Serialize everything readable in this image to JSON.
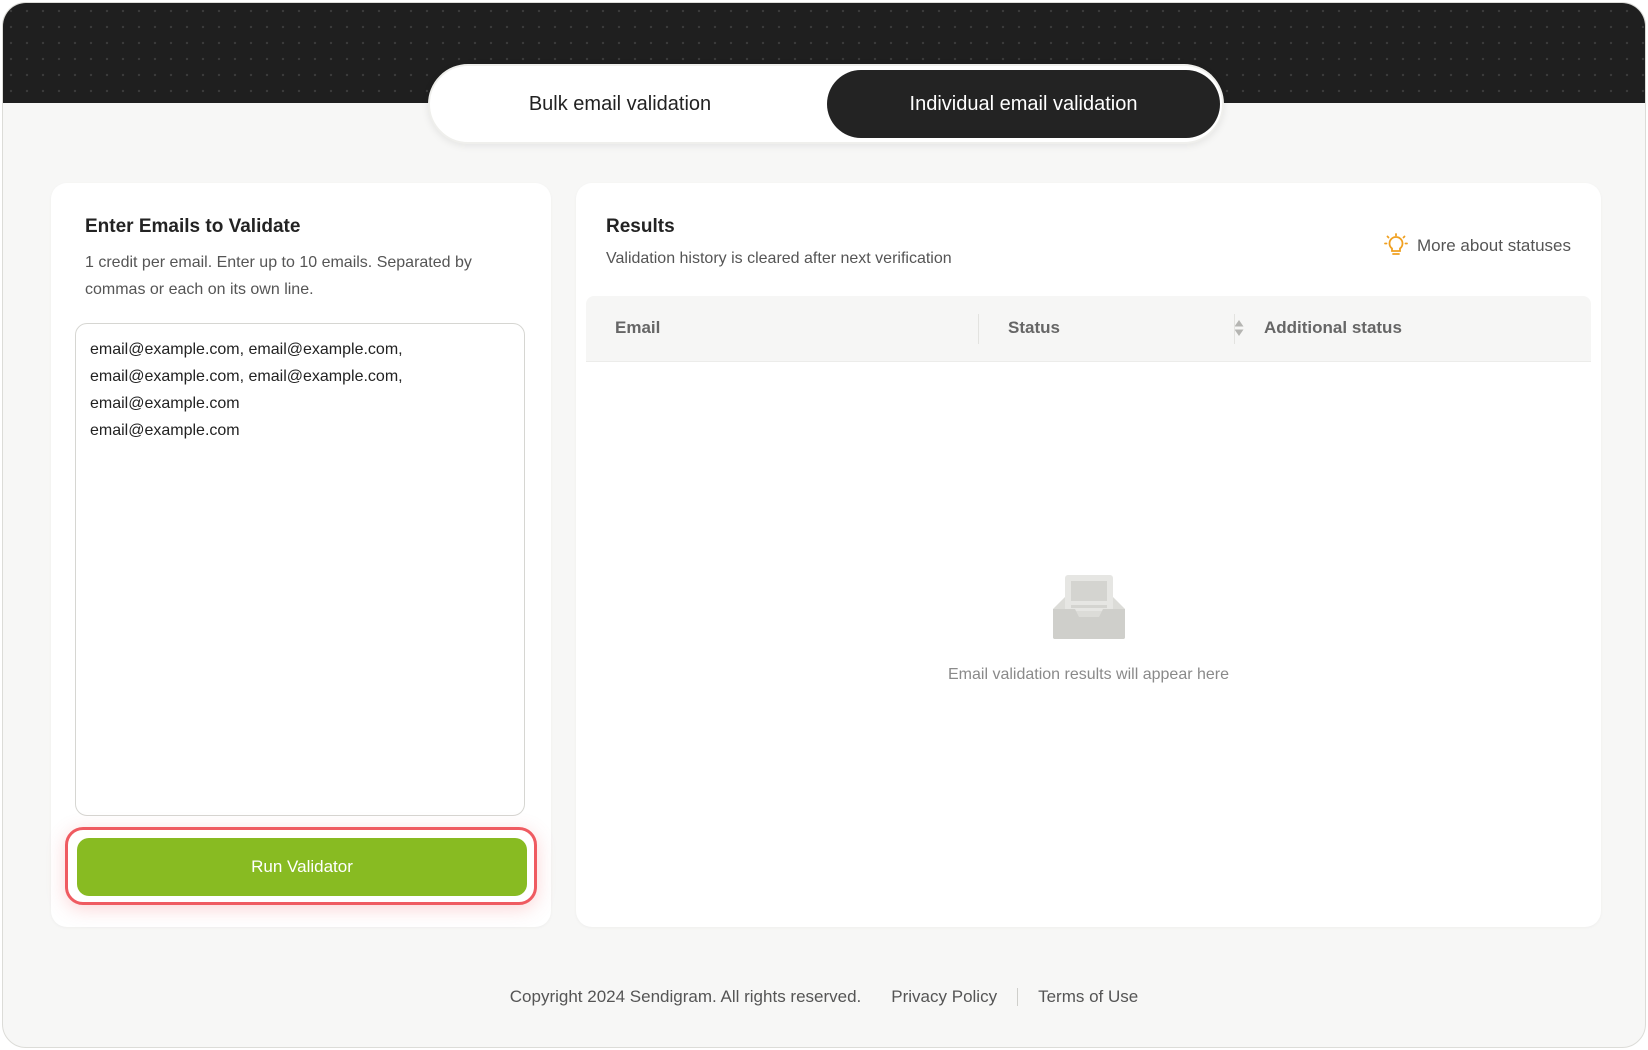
{
  "tabs": [
    {
      "label": "Bulk email validation",
      "active": false
    },
    {
      "label": "Individual email validation",
      "active": true
    }
  ],
  "input_panel": {
    "title": "Enter Emails to Validate",
    "subtitle_line1": "1 credit per email. Enter up to 10 emails. Separated by",
    "subtitle_line2": "commas or each on its own line.",
    "email_lines": [
      "email@example.com, email@example.com,",
      "email@example.com, email@example.com,",
      "email@example.com",
      "email@example.com"
    ],
    "run_button_label": "Run Validator"
  },
  "results_panel": {
    "title": "Results",
    "subtitle": "Validation history is cleared after next verification",
    "more_statuses_label": "More about statuses",
    "columns": [
      "Email",
      "Status",
      "Additional status"
    ],
    "empty_message": "Email validation results will appear here"
  },
  "footer": {
    "copyright": "Copyright 2024 Sendigram. All rights reserved.",
    "privacy_label": "Privacy Policy",
    "terms_label": "Terms of Use"
  },
  "colors": {
    "accent_green": "#88bb22",
    "highlight_red": "#ef5b61",
    "dark": "#232323",
    "bulb_orange": "#f0a020"
  },
  "icons": {
    "more_statuses": "lightbulb-icon",
    "status_sort": "sort-icon",
    "empty_state": "inbox-icon"
  }
}
